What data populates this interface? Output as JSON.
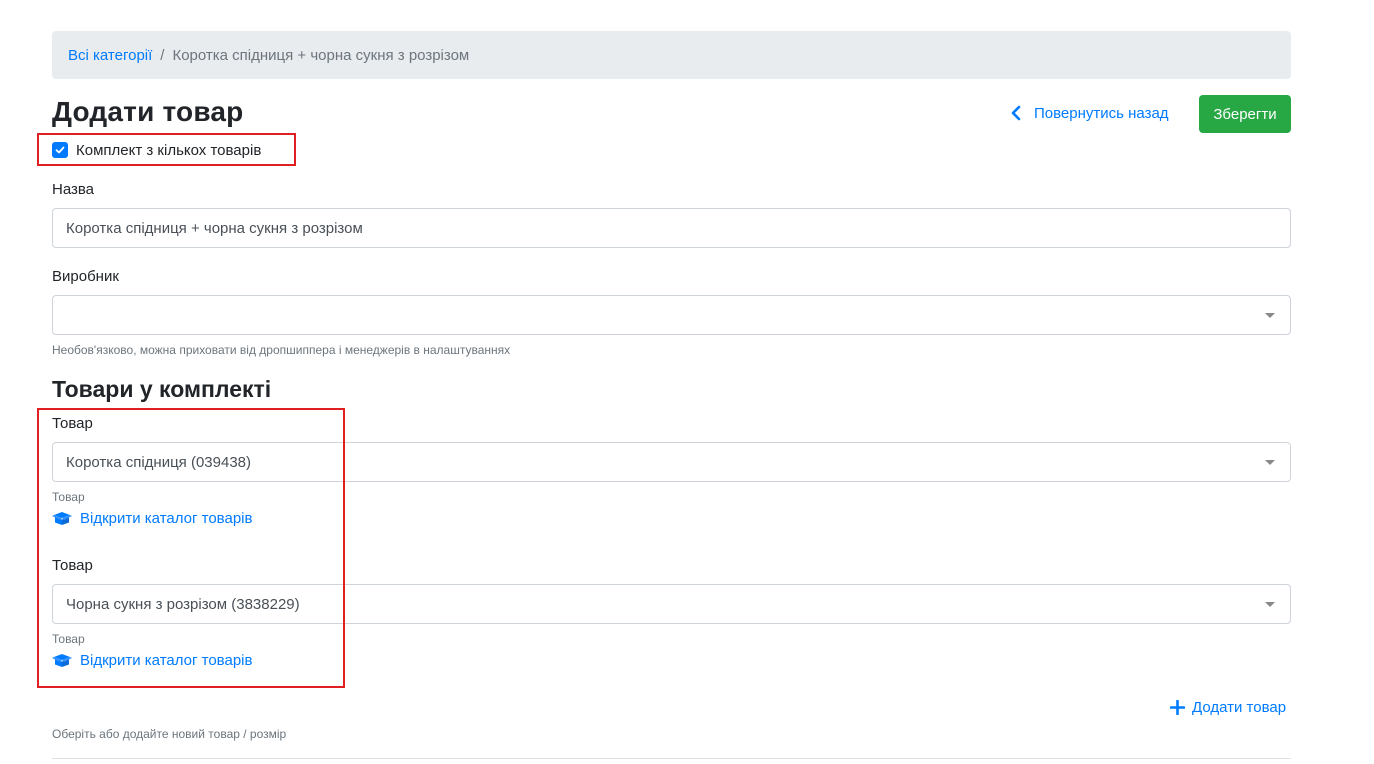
{
  "breadcrumb": {
    "root": "Всі категорії",
    "separator": "/",
    "current": "Коротка спідниця + чорна сукня з розрізом"
  },
  "header": {
    "title": "Додати товар",
    "back_label": "Повернутись назад",
    "save_label": "Зберегти"
  },
  "kit_checkbox": {
    "label": "Комплект з кількох товарів",
    "checked": true
  },
  "form": {
    "name_label": "Назва",
    "name_value": "Коротка спідниця + чорна сукня з розрізом",
    "manufacturer_label": "Виробник",
    "manufacturer_value": "",
    "manufacturer_hint": "Необов'язково, можна приховати від дропшиппера і менеджерів в налаштуваннях"
  },
  "kit_section": {
    "title": "Товари у комплекті",
    "items": [
      {
        "label": "Товар",
        "value": "Коротка спідниця (039438)",
        "hint": "Товар",
        "catalog_link": "Відкрити каталог товарів"
      },
      {
        "label": "Товар",
        "value": "Чорна сукня з розрізом (3838229)",
        "hint": "Товар",
        "catalog_link": "Відкрити каталог товарів"
      }
    ],
    "add_label": "Додати товар",
    "footer_hint": "Оберіть або додайте новий товар / розмір"
  },
  "colors": {
    "link": "#007bff",
    "save": "#28a745",
    "highlight": "#e02020",
    "breadcrumb_bg": "#e9ecef"
  }
}
